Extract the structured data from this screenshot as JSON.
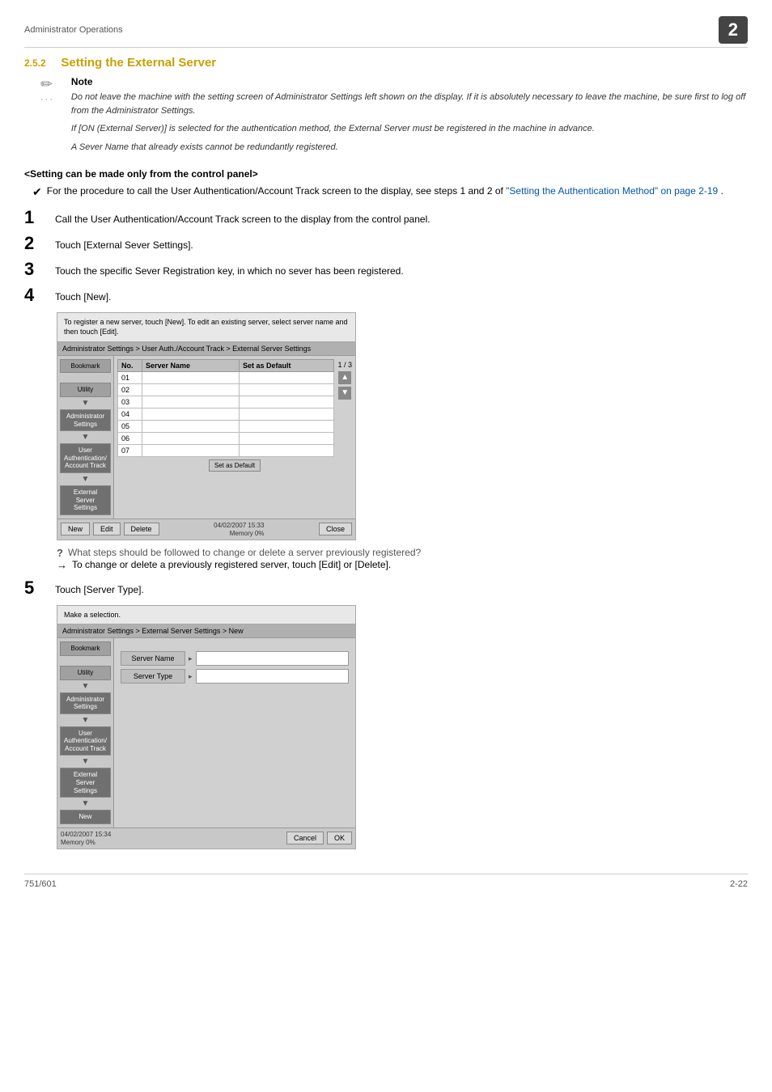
{
  "header": {
    "label": "Administrator Operations",
    "page_badge": "2"
  },
  "section": {
    "number": "2.5.2",
    "title": "Setting the External Server"
  },
  "note": {
    "icon": "✏",
    "dots": "...",
    "title": "Note",
    "lines": [
      "Do not leave the machine with the setting screen of Administrator Settings left shown on the display. If it is absolutely necessary to leave the machine, be sure first to log off from the Administrator Settings.",
      "If [ON (External Server)] is selected for the authentication method, the External Server must be registered in the machine in advance.",
      "A Sever Name that already exists cannot be redundantly registered."
    ]
  },
  "setting_panel": {
    "label": "<Setting can be made only from the control panel>"
  },
  "bullet": {
    "check": "✔",
    "text": "For the procedure to call the User Authentication/Account Track screen to the display, see steps 1 and 2 of ",
    "link": "\"Setting the Authentication Method\" on page 2-19",
    "text2": "."
  },
  "steps": [
    {
      "number": "1",
      "text": "Call the User Authentication/Account Track screen to the display from the control panel."
    },
    {
      "number": "2",
      "text": "Touch [External Sever Settings]."
    },
    {
      "number": "3",
      "text": "Touch the specific Sever Registration key, in which no sever has been registered."
    },
    {
      "number": "4",
      "text": "Touch [New]."
    },
    {
      "number": "5",
      "text": "Touch [Server Type]."
    }
  ],
  "screenshot1": {
    "instruction": "To register a new server, touch [New]. To edit an existing server, select server name and then touch [Edit].",
    "breadcrumb": "Administrator Settings > User Auth./Account Track > External Server Settings",
    "sidebar": {
      "bookmark": "Bookmark",
      "utility": "Utility",
      "admin": "Administrator Settings",
      "user": "User Authentication/ Account Track",
      "external": "External Server Settings"
    },
    "table": {
      "col1": "No.",
      "col2": "Server Name",
      "col3": "Set as Default",
      "rows": [
        "01",
        "02",
        "03",
        "04",
        "05",
        "06",
        "07"
      ]
    },
    "pagination": "1 / 3",
    "default_btn": "Set as Default",
    "buttons": {
      "new": "New",
      "edit": "Edit",
      "delete": "Delete",
      "close": "Close"
    },
    "datetime": "04/02/2007  15:33",
    "memory": "Memory   0%"
  },
  "qa": {
    "question_icon": "?",
    "question": "What steps should be followed to change or delete a server previously registered?",
    "answer_icon": "→",
    "answer": "To change or delete a previously registered server, touch [Edit] or [Delete]."
  },
  "screenshot2": {
    "instruction": "Make a selection.",
    "breadcrumb": "Administrator Settings > External Server Settings > New",
    "sidebar": {
      "bookmark": "Bookmark",
      "utility": "Utility",
      "admin": "Administrator Settings",
      "user": "User Authentication/ Account Track",
      "external": "External Server Settings",
      "new": "New"
    },
    "fields": [
      {
        "label": "Server Name",
        "arrow": "✎"
      },
      {
        "label": "Server Type",
        "arrow": "✎"
      }
    ],
    "buttons": {
      "cancel": "Cancel",
      "ok": "OK"
    },
    "datetime": "04/02/2007  15:34",
    "memory": "Memory   0%"
  },
  "footer": {
    "left": "751/601",
    "right": "2-22"
  }
}
